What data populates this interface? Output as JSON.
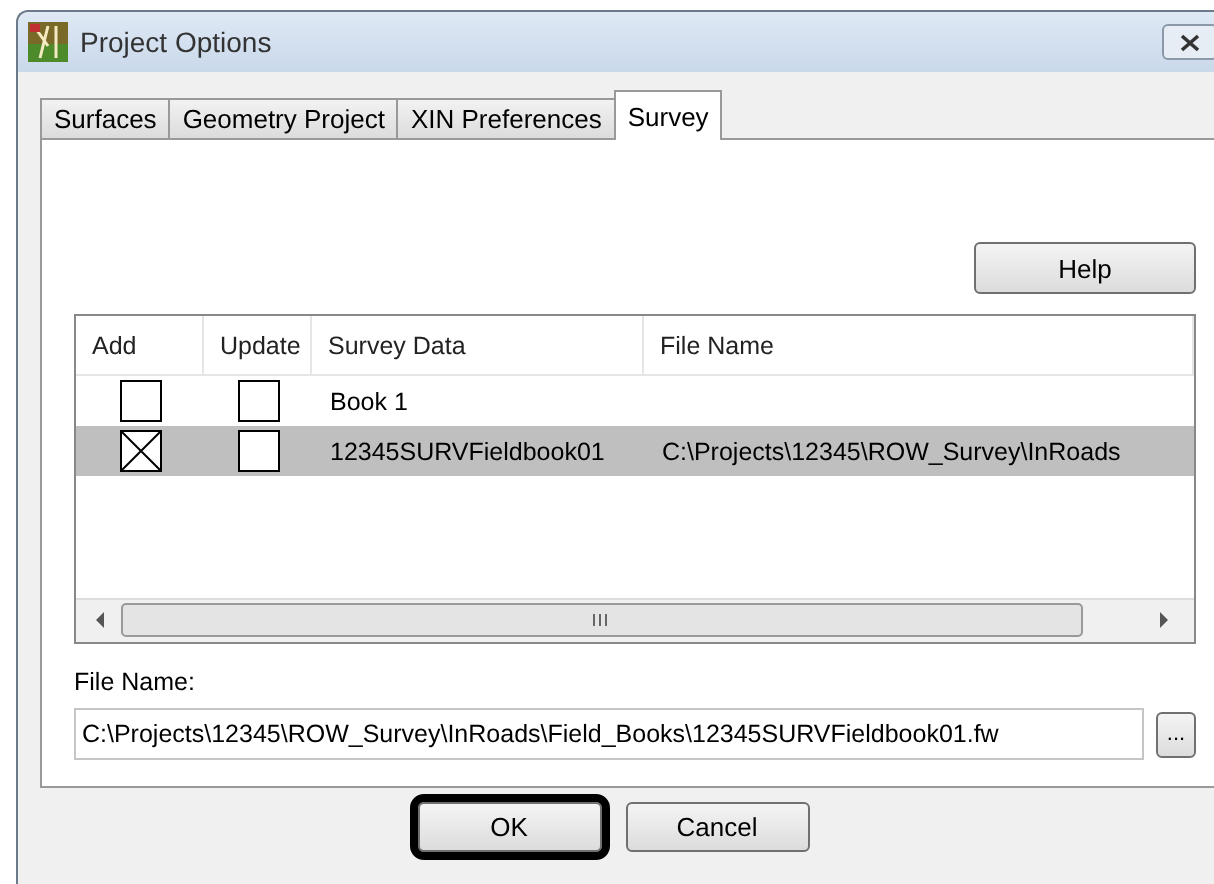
{
  "window": {
    "title": "Project Options"
  },
  "tabs": [
    {
      "label": "Surfaces",
      "selected": false
    },
    {
      "label": "Geometry Project",
      "selected": false
    },
    {
      "label": "XIN Preferences",
      "selected": false
    },
    {
      "label": "Survey",
      "selected": true
    }
  ],
  "help_button": "Help",
  "list": {
    "columns": [
      "Add",
      "Update",
      "Survey Data",
      "File Name"
    ],
    "rows": [
      {
        "add": false,
        "update": false,
        "survey_data": "Book 1",
        "file_name": "",
        "selected": false
      },
      {
        "add": true,
        "update": false,
        "survey_data": "12345SURVFieldbook01",
        "file_name": "C:\\Projects\\12345\\ROW_Survey\\InRoads",
        "selected": true
      }
    ]
  },
  "file_name": {
    "label": "File Name:",
    "value": "C:\\Projects\\12345\\ROW_Survey\\InRoads\\Field_Books\\12345SURVFieldbook01.fw",
    "browse": "..."
  },
  "buttons": [
    {
      "label": "OK",
      "focused": true
    },
    {
      "label": "Cancel",
      "focused": false
    }
  ]
}
